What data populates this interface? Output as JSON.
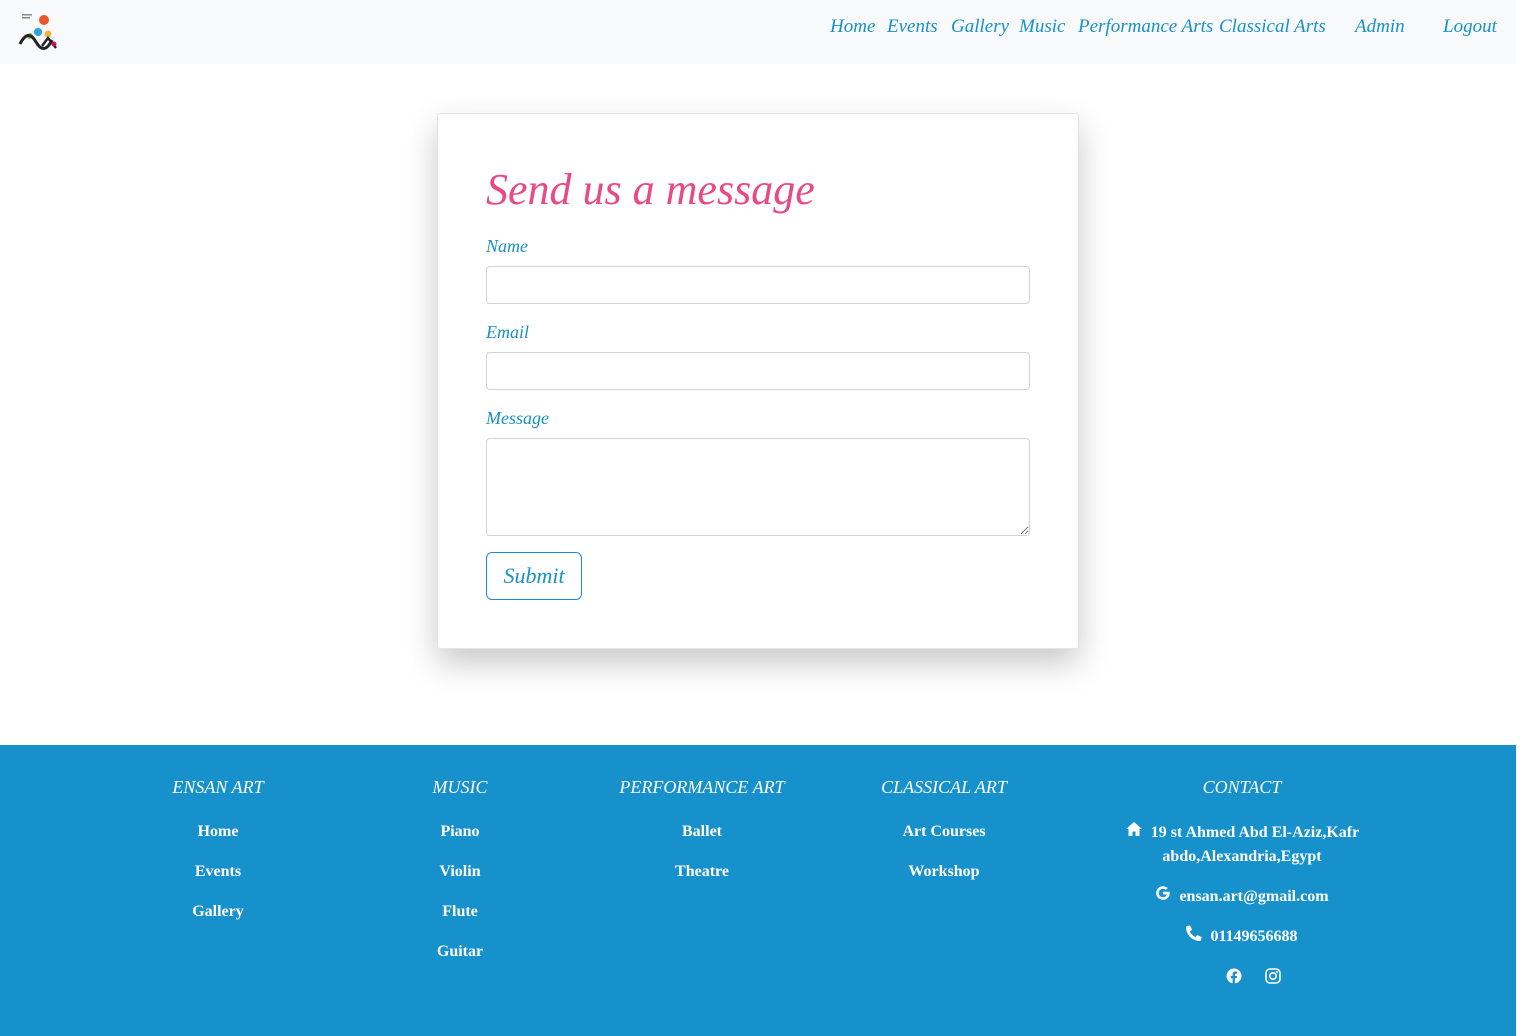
{
  "nav": {
    "items": [
      "Home",
      "Events",
      "Gallery",
      "Music",
      "Performance Arts",
      "Classical Arts",
      "Admin",
      "Logout"
    ]
  },
  "colors": {
    "accent": "#1791c9",
    "title": "#e84a87",
    "footer_bg": "#1791cb"
  },
  "form": {
    "title": "Send us a message",
    "name_label": "Name",
    "email_label": "Email",
    "message_label": "Message",
    "submit_label": "Submit"
  },
  "footer": {
    "columns": [
      {
        "heading": "Ensan Art",
        "links": [
          "Home",
          "Events",
          "Gallery"
        ]
      },
      {
        "heading": "Music",
        "links": [
          "Piano",
          "Violin",
          "Flute",
          "Guitar"
        ]
      },
      {
        "heading": "Performance Art",
        "links": [
          "Ballet",
          "Theatre"
        ]
      },
      {
        "heading": "Classical Art",
        "links": [
          "Art Courses",
          "Workshop"
        ]
      }
    ],
    "contact": {
      "heading": "Contact",
      "address_line1": "19 st Ahmed Abd El-Aziz,Kafr",
      "address_line2": "abdo,Alexandria,Egypt",
      "email": "ensan.art@gmail.com",
      "phone": "01149656688",
      "icons": [
        "home-icon",
        "google-icon",
        "phone-icon",
        "facebook-icon",
        "instagram-icon"
      ]
    }
  }
}
